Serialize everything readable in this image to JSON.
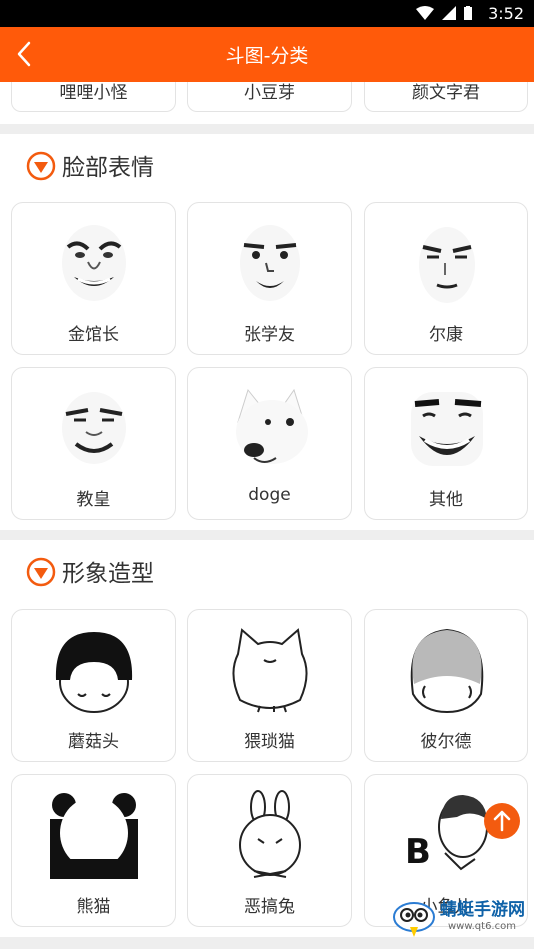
{
  "status_bar": {
    "time": "3:52"
  },
  "app_bar": {
    "title": "斗图-分类"
  },
  "top_row": {
    "items": [
      "哩哩小怪",
      "小豆芽",
      "颜文字君"
    ]
  },
  "sections": [
    {
      "title": "脸部表情",
      "items": [
        "金馆长",
        "张学友",
        "尔康",
        "教皇",
        "doge",
        "其他"
      ]
    },
    {
      "title": "形象造型",
      "items": [
        "蘑菇头",
        "猥琐猫",
        "彼尔德",
        "熊猫",
        "恶搞兔",
        "小鱼儿"
      ]
    }
  ],
  "watermark": {
    "name": "蜻蜓手游网",
    "url": "www.qt6.com"
  },
  "colors": {
    "accent": "#ff5a0a",
    "divider": "#eeeeee",
    "text": "#333333"
  },
  "icons": {
    "back": "back-chevron-icon",
    "section": "down-triangle-icon",
    "fab": "arrow-up-icon"
  }
}
